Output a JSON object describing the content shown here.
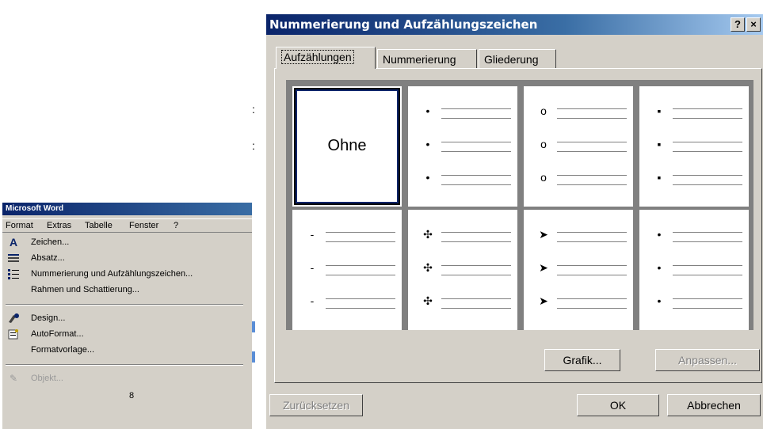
{
  "word_menu": {
    "window_title": "Microsoft Word",
    "menubar": [
      "Format",
      "Extras",
      "Tabelle",
      "Fenster",
      "?"
    ],
    "items": [
      {
        "label": "Zeichen...",
        "icon": "font-a-icon"
      },
      {
        "label": "Absatz...",
        "icon": "paragraph-icon"
      },
      {
        "label": "Nummerierung und Aufzählungszeichen...",
        "icon": "list-icon"
      },
      {
        "label": "Rahmen und Schattierung...",
        "icon": ""
      },
      {
        "label": "Design...",
        "icon": "design-brush-icon"
      },
      {
        "label": "AutoFormat...",
        "icon": "autoformat-icon"
      },
      {
        "label": "Formatvorlage...",
        "icon": ""
      },
      {
        "label": "Objekt...",
        "icon": "object-icon"
      }
    ],
    "footer_text": "8"
  },
  "dialog": {
    "title": "Nummerierung und Aufzählungszeichen",
    "help_label": "?",
    "close_label": "×",
    "tabs": [
      "Aufzählungen",
      "Nummerierung",
      "Gliederung"
    ],
    "active_tab": "Aufzählungen",
    "gallery": [
      {
        "type": "none",
        "label": "Ohne",
        "selected": true
      },
      {
        "type": "bullets",
        "char": "•"
      },
      {
        "type": "bullets",
        "char": "o"
      },
      {
        "type": "bullets",
        "char": "▪"
      },
      {
        "type": "bullets",
        "char": "-"
      },
      {
        "type": "bullets",
        "char": "✣"
      },
      {
        "type": "bullets",
        "char": "➤"
      },
      {
        "type": "bullets",
        "char": "•"
      }
    ],
    "buttons": {
      "picture": "Grafik...",
      "customize": "Anpassen...",
      "reset": "Zurücksetzen",
      "ok": "OK",
      "cancel": "Abbrechen"
    },
    "colors": {
      "titlebar": "#0a246a",
      "face": "#d4d0c8",
      "selection": "#0a246a"
    }
  }
}
